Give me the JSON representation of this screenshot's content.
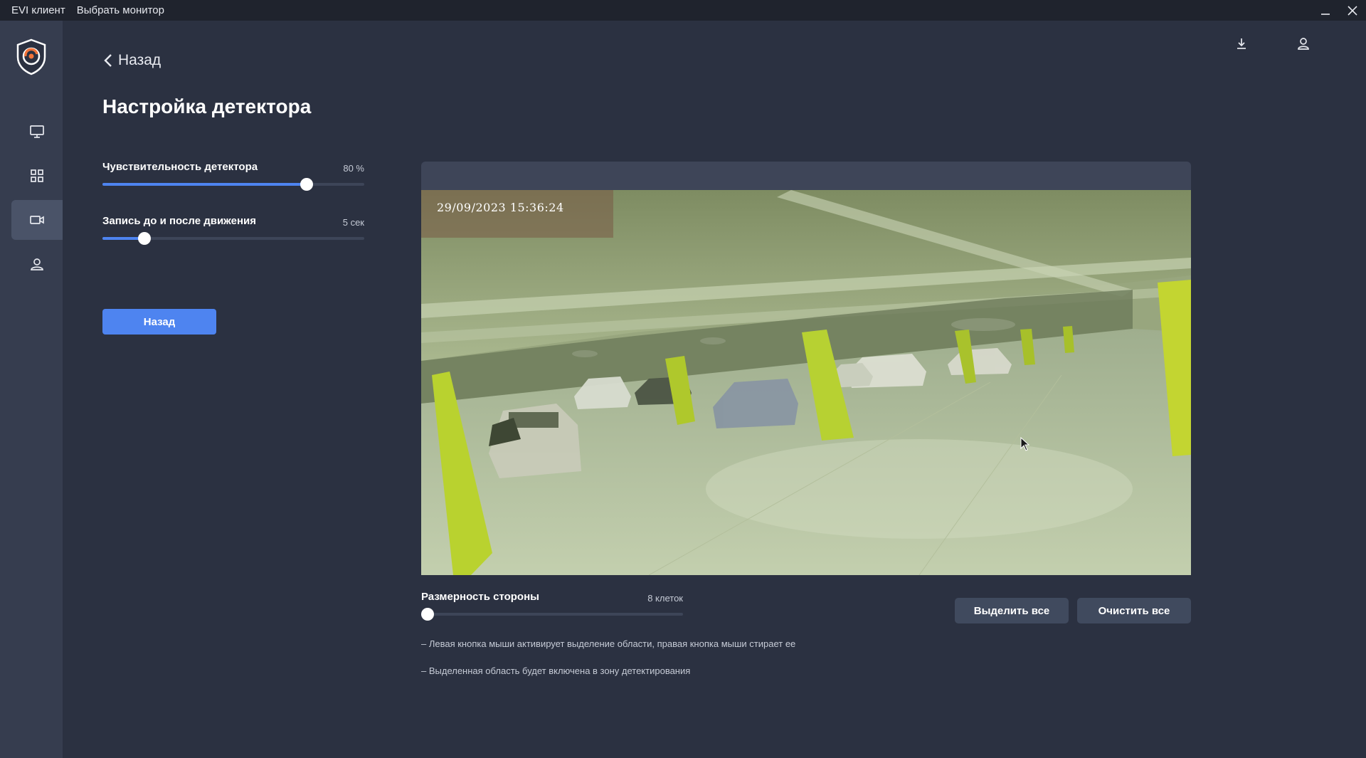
{
  "titlebar": {
    "app_name": "EVI клиент",
    "select_monitor": "Выбрать монитор"
  },
  "sidebar": {
    "items": [
      {
        "name": "monitor-icon",
        "active": false
      },
      {
        "name": "grid-icon",
        "active": false
      },
      {
        "name": "camera-icon",
        "active": true
      },
      {
        "name": "user-icon",
        "active": false
      }
    ]
  },
  "header": {
    "icons": [
      "download-icon",
      "user-icon"
    ]
  },
  "back_link": "Назад",
  "page_title": "Настройка детектора",
  "sliders": [
    {
      "label": "Чувствительность детектора",
      "value_text": "80 %",
      "fraction": 0.78
    },
    {
      "label": "Запись до и после движения",
      "value_text": "5 сек",
      "fraction": 0.16
    }
  ],
  "back_button": "Назад",
  "camera": {
    "timestamp": "29/09/2023 15:36:24"
  },
  "grid_slider": {
    "label": "Размерность стороны",
    "value_text": "8 клеток",
    "fraction": 0.025
  },
  "buttons": {
    "select_all": "Выделить все",
    "clear_all": "Очистить все"
  },
  "hints": [
    "– Левая кнопка мыши активирует выделение области, правая кнопка мыши стирает ее",
    "– Выделенная область будет включена в зону детектирования"
  ],
  "colors": {
    "accent": "#4e84f0",
    "background": "#2b3141",
    "sidebar": "#363d4f",
    "titlebar": "#1f232d"
  }
}
